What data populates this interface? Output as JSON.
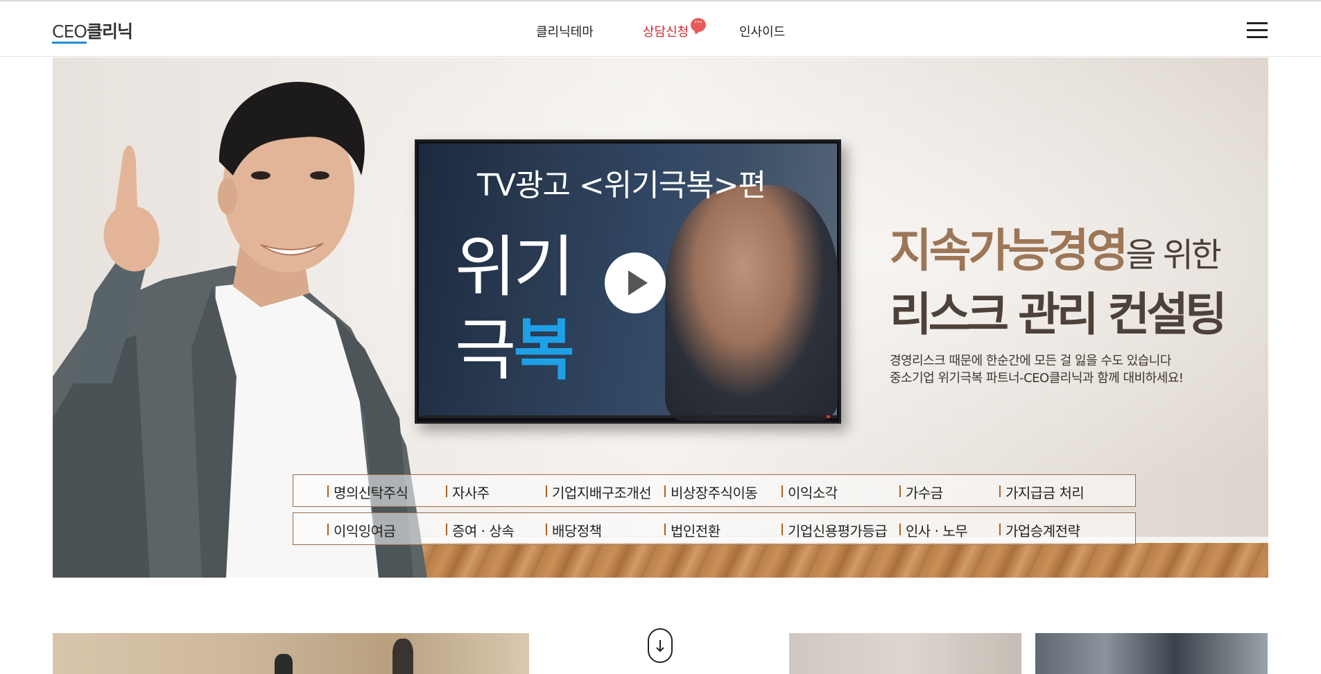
{
  "header": {
    "logo_ceo": "CEO",
    "logo_rest": "클리닉",
    "nav": {
      "theme": "클리닉테마",
      "consult": "상담신청",
      "insight": "인사이드"
    },
    "chat_badge": "···",
    "menu_icon": "hamburger-menu-icon"
  },
  "hero": {
    "tv": {
      "title": "TV광고 <위기극복>편",
      "big_line1": "위기",
      "big_line2_plain": "극",
      "big_line2_highlight": "복",
      "play_icon": "play-icon"
    },
    "copy": {
      "line1_strong": "지속가능경영",
      "line1_tail": "을 위한",
      "line2": "리스크 관리 컨설팅",
      "desc1": "경영리스크 때문에 한순간에 모든 걸 잃을 수도 있습니다",
      "desc2": "중소기업 위기극복 파트너-CEO클리닉과 함께 대비하세요!"
    },
    "keywords_row1": [
      "명의신탁주식",
      "자사주",
      "기업지배구조개선",
      "비상장주식이동",
      "이익소각",
      "가수금",
      "가지급금 처리"
    ],
    "keywords_row2": [
      "이익잉여금",
      "증여 · 상속",
      "배당정책",
      "법인전환",
      "기업신용평가등급",
      "인사 · 노무",
      "가업승계전략"
    ]
  },
  "bottom": {
    "scroll_icon": "arrow-down-icon"
  },
  "colors": {
    "accent_red": "#d7262f",
    "accent_blue": "#1ea0e6",
    "copy_brown": "#9c7656",
    "copy_dark": "#4d4139",
    "keyword_border": "#9a6a48"
  }
}
